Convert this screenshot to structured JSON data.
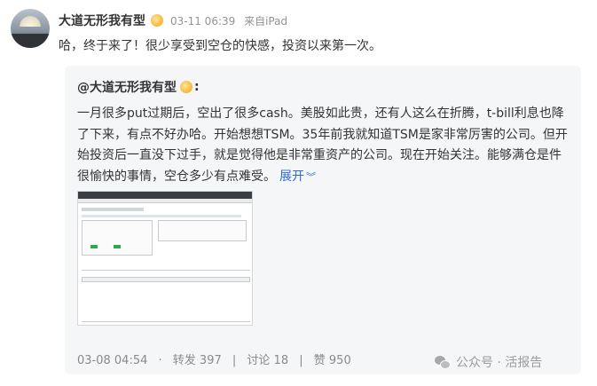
{
  "post": {
    "author": "大道无形我有型",
    "date": "03-11 06:39",
    "source": "来自iPad",
    "text": "哈，终于来了！很少享受到空仓的快感，投资以来第一次。"
  },
  "quote": {
    "author_line": "@大道无形我有型",
    "colon": ":",
    "text": "一月很多put过期后，空出了很多cash。美股如此贵，还有人这么在折腾，t-bill利息也降了下来，有点不好办哈。开始想想TSM。35年前我就知道TSM是家非常厉害的公司。但开始投资后一直没下过手，就是觉得他是非常重资产的公司。现在开始关注。能够满仓是件很愉快的事情，空仓多少有点难受。",
    "expand_label": "展开",
    "expand_icon": "chevron-down-icon",
    "footer": {
      "date": "03-08 04:54",
      "repost": "转发 397",
      "comment": "讨论 18",
      "like": "赞 950"
    }
  },
  "watermark": {
    "text": "公众号 · 活报告",
    "icon": "wechat-icon"
  },
  "colors": {
    "link": "#2d6ad8",
    "meta": "#939393",
    "quote_bg": "#f5f6f8"
  }
}
